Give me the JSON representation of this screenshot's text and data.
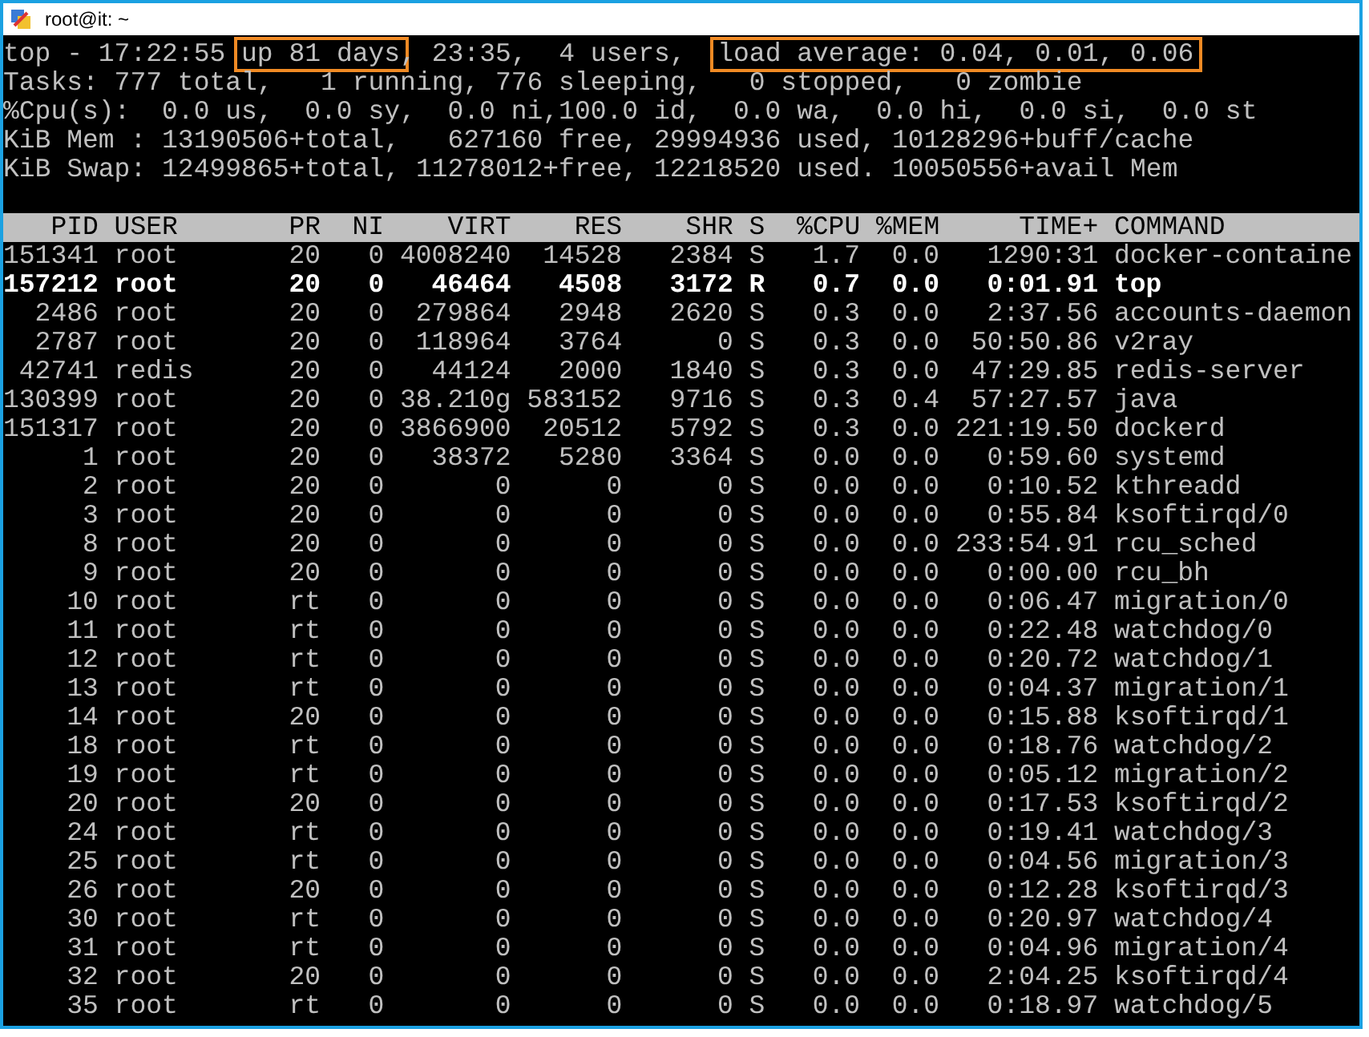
{
  "window": {
    "title": "root@it: ~"
  },
  "summary": [
    [
      {
        "text": "top - 17:22:55 ",
        "highlighted": false
      },
      {
        "text": "up 81 days",
        "highlighted": true
      },
      {
        "text": ", 23:35,  4 users,  ",
        "highlighted": false
      },
      {
        "text": "load average: 0.04, 0.01, 0.06",
        "highlighted": true
      }
    ],
    [
      {
        "text": "Tasks: 777 total,   1 running, 776 sleeping,   0 stopped,   0 zombie",
        "highlighted": false
      }
    ],
    [
      {
        "text": "%Cpu(s):  0.0 us,  0.0 sy,  0.0 ni,100.0 id,  0.0 wa,  0.0 hi,  0.0 si,  0.0 st",
        "highlighted": false
      }
    ],
    [
      {
        "text": "KiB Mem : 13190506+total,   627160 free, 29994936 used, 10128296+buff/cache",
        "highlighted": false
      }
    ],
    [
      {
        "text": "KiB Swap: 12499865+total, 11278012+free, 12218520 used. 10050556+avail Mem",
        "highlighted": false
      }
    ]
  ],
  "table": {
    "columns": [
      "PID",
      "USER",
      "PR",
      "NI",
      "VIRT",
      "RES",
      "SHR",
      "S",
      "%CPU",
      "%MEM",
      "TIME+",
      "COMMAND"
    ],
    "rows": [
      {
        "cells": [
          "151341",
          "root",
          "20",
          "0",
          "4008240",
          "14528",
          "2384",
          "S",
          "1.7",
          "0.0",
          "1290:31",
          "docker-containe"
        ],
        "highlighted": false
      },
      {
        "cells": [
          "157212",
          "root",
          "20",
          "0",
          "46464",
          "4508",
          "3172",
          "R",
          "0.7",
          "0.0",
          "0:01.91",
          "top"
        ],
        "highlighted": true
      },
      {
        "cells": [
          "2486",
          "root",
          "20",
          "0",
          "279864",
          "2948",
          "2620",
          "S",
          "0.3",
          "0.0",
          "2:37.56",
          "accounts-daemon"
        ],
        "highlighted": false
      },
      {
        "cells": [
          "2787",
          "root",
          "20",
          "0",
          "118964",
          "3764",
          "0",
          "S",
          "0.3",
          "0.0",
          "50:50.86",
          "v2ray"
        ],
        "highlighted": false
      },
      {
        "cells": [
          "42741",
          "redis",
          "20",
          "0",
          "44124",
          "2000",
          "1840",
          "S",
          "0.3",
          "0.0",
          "47:29.85",
          "redis-server"
        ],
        "highlighted": false
      },
      {
        "cells": [
          "130399",
          "root",
          "20",
          "0",
          "38.210g",
          "583152",
          "9716",
          "S",
          "0.3",
          "0.4",
          "57:27.57",
          "java"
        ],
        "highlighted": false
      },
      {
        "cells": [
          "151317",
          "root",
          "20",
          "0",
          "3866900",
          "20512",
          "5792",
          "S",
          "0.3",
          "0.0",
          "221:19.50",
          "dockerd"
        ],
        "highlighted": false
      },
      {
        "cells": [
          "1",
          "root",
          "20",
          "0",
          "38372",
          "5280",
          "3364",
          "S",
          "0.0",
          "0.0",
          "0:59.60",
          "systemd"
        ],
        "highlighted": false
      },
      {
        "cells": [
          "2",
          "root",
          "20",
          "0",
          "0",
          "0",
          "0",
          "S",
          "0.0",
          "0.0",
          "0:10.52",
          "kthreadd"
        ],
        "highlighted": false
      },
      {
        "cells": [
          "3",
          "root",
          "20",
          "0",
          "0",
          "0",
          "0",
          "S",
          "0.0",
          "0.0",
          "0:55.84",
          "ksoftirqd/0"
        ],
        "highlighted": false
      },
      {
        "cells": [
          "8",
          "root",
          "20",
          "0",
          "0",
          "0",
          "0",
          "S",
          "0.0",
          "0.0",
          "233:54.91",
          "rcu_sched"
        ],
        "highlighted": false
      },
      {
        "cells": [
          "9",
          "root",
          "20",
          "0",
          "0",
          "0",
          "0",
          "S",
          "0.0",
          "0.0",
          "0:00.00",
          "rcu_bh"
        ],
        "highlighted": false
      },
      {
        "cells": [
          "10",
          "root",
          "rt",
          "0",
          "0",
          "0",
          "0",
          "S",
          "0.0",
          "0.0",
          "0:06.47",
          "migration/0"
        ],
        "highlighted": false
      },
      {
        "cells": [
          "11",
          "root",
          "rt",
          "0",
          "0",
          "0",
          "0",
          "S",
          "0.0",
          "0.0",
          "0:22.48",
          "watchdog/0"
        ],
        "highlighted": false
      },
      {
        "cells": [
          "12",
          "root",
          "rt",
          "0",
          "0",
          "0",
          "0",
          "S",
          "0.0",
          "0.0",
          "0:20.72",
          "watchdog/1"
        ],
        "highlighted": false
      },
      {
        "cells": [
          "13",
          "root",
          "rt",
          "0",
          "0",
          "0",
          "0",
          "S",
          "0.0",
          "0.0",
          "0:04.37",
          "migration/1"
        ],
        "highlighted": false
      },
      {
        "cells": [
          "14",
          "root",
          "20",
          "0",
          "0",
          "0",
          "0",
          "S",
          "0.0",
          "0.0",
          "0:15.88",
          "ksoftirqd/1"
        ],
        "highlighted": false
      },
      {
        "cells": [
          "18",
          "root",
          "rt",
          "0",
          "0",
          "0",
          "0",
          "S",
          "0.0",
          "0.0",
          "0:18.76",
          "watchdog/2"
        ],
        "highlighted": false
      },
      {
        "cells": [
          "19",
          "root",
          "rt",
          "0",
          "0",
          "0",
          "0",
          "S",
          "0.0",
          "0.0",
          "0:05.12",
          "migration/2"
        ],
        "highlighted": false
      },
      {
        "cells": [
          "20",
          "root",
          "20",
          "0",
          "0",
          "0",
          "0",
          "S",
          "0.0",
          "0.0",
          "0:17.53",
          "ksoftirqd/2"
        ],
        "highlighted": false
      },
      {
        "cells": [
          "24",
          "root",
          "rt",
          "0",
          "0",
          "0",
          "0",
          "S",
          "0.0",
          "0.0",
          "0:19.41",
          "watchdog/3"
        ],
        "highlighted": false
      },
      {
        "cells": [
          "25",
          "root",
          "rt",
          "0",
          "0",
          "0",
          "0",
          "S",
          "0.0",
          "0.0",
          "0:04.56",
          "migration/3"
        ],
        "highlighted": false
      },
      {
        "cells": [
          "26",
          "root",
          "20",
          "0",
          "0",
          "0",
          "0",
          "S",
          "0.0",
          "0.0",
          "0:12.28",
          "ksoftirqd/3"
        ],
        "highlighted": false
      },
      {
        "cells": [
          "30",
          "root",
          "rt",
          "0",
          "0",
          "0",
          "0",
          "S",
          "0.0",
          "0.0",
          "0:20.97",
          "watchdog/4"
        ],
        "highlighted": false
      },
      {
        "cells": [
          "31",
          "root",
          "rt",
          "0",
          "0",
          "0",
          "0",
          "S",
          "0.0",
          "0.0",
          "0:04.96",
          "migration/4"
        ],
        "highlighted": false
      },
      {
        "cells": [
          "32",
          "root",
          "20",
          "0",
          "0",
          "0",
          "0",
          "S",
          "0.0",
          "0.0",
          "2:04.25",
          "ksoftirqd/4"
        ],
        "highlighted": false
      },
      {
        "cells": [
          "35",
          "root",
          "rt",
          "0",
          "0",
          "0",
          "0",
          "S",
          "0.0",
          "0.0",
          "0:18.97",
          "watchdog/5"
        ],
        "highlighted": false
      }
    ]
  }
}
